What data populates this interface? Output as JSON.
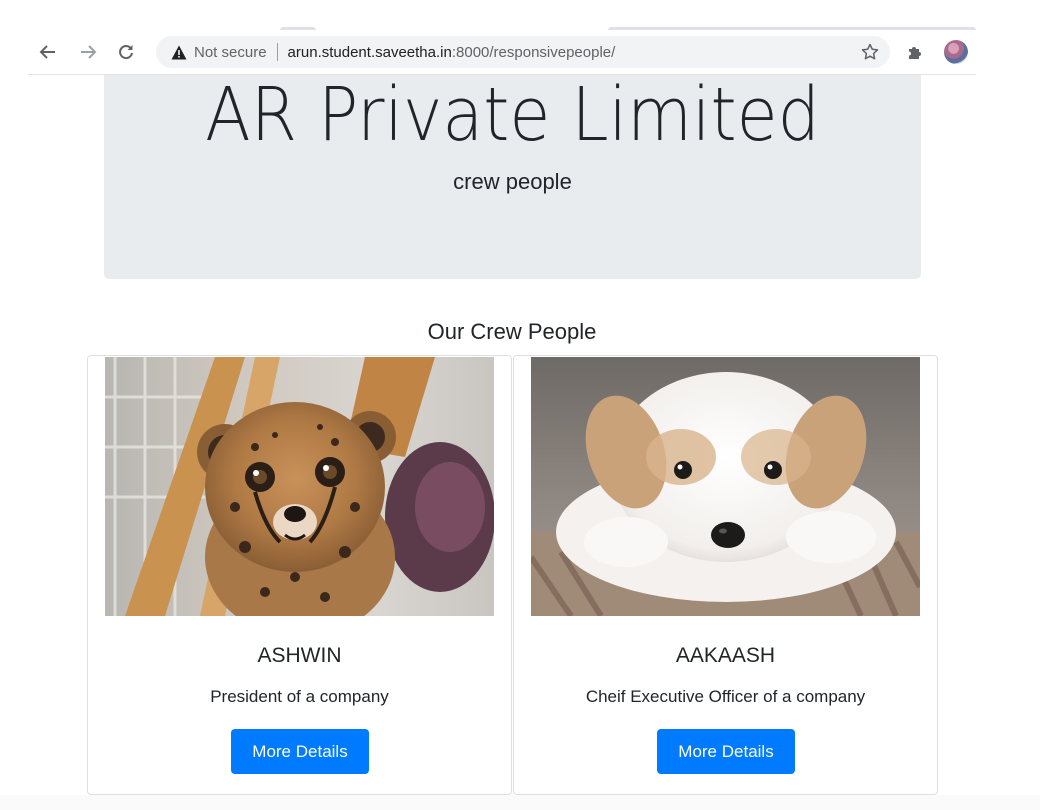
{
  "browser": {
    "security_label": "Not secure",
    "url_host": "arun.student.saveetha.in",
    "url_rest": ":8000/responsivepeople/"
  },
  "jumbotron": {
    "title": "AR Private Limited",
    "subtitle": "crew people"
  },
  "section": {
    "heading": "Our Crew People"
  },
  "cards": [
    {
      "name": "ASHWIN",
      "role": "President of a company",
      "button": "More Details",
      "image": "cheetah-cub-photo"
    },
    {
      "name": "AAKAASH",
      "role": "Cheif Executive Officer of a company",
      "button": "More Details",
      "image": "puppy-photo"
    }
  ],
  "colors": {
    "primary_button": "#007bff",
    "jumbotron_bg": "#e9ecef"
  }
}
